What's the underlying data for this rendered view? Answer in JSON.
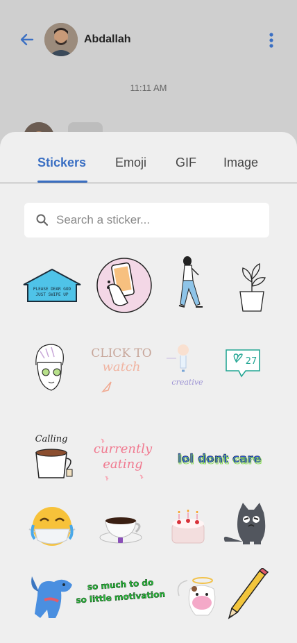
{
  "header": {
    "contact_name": "Abdallah"
  },
  "chat": {
    "timestamp": "11:11 AM"
  },
  "tabs": [
    {
      "label": "Stickers",
      "active": true
    },
    {
      "label": "Emoji",
      "active": false
    },
    {
      "label": "GIF",
      "active": false
    },
    {
      "label": "Image",
      "active": false
    }
  ],
  "search": {
    "placeholder": "Search a sticker...",
    "value": ""
  },
  "stickers": {
    "row1": [
      "please-dear-god-just-swipe-up",
      "hand-holding-phone",
      "walking-woman",
      "potted-plant"
    ],
    "row2": [
      "towel-face-mask-woman",
      "click-to-watch",
      "creative-lightbulb",
      "like-notification"
    ],
    "row3": [
      "coffee-cup",
      "currently-eating",
      "lol-dont-care",
      "sleepy-emoji"
    ],
    "row4": [
      "masked-crying-emoji",
      "coffee-cup-saucer",
      "birthday-cake",
      "grumpy-cat"
    ],
    "row5": [
      "blue-dog",
      "so-much-to-do",
      "cow-angel",
      "pencil"
    ],
    "text": {
      "swipe_up": "PLEASE DEAR GOD JUST SWIPE UP",
      "click_to": "CLICK TO",
      "watch": "watch",
      "creative": "creative",
      "likes": "27",
      "calling": "Calling",
      "currently": "currently",
      "eating": "eating",
      "lol": "lol dont care",
      "so_much": "so much to do",
      "so_little": "so little motivation"
    }
  },
  "colors": {
    "accent": "#3a6fc3",
    "sheet_bg": "#efefef",
    "backdrop": "#cfcfcf"
  }
}
